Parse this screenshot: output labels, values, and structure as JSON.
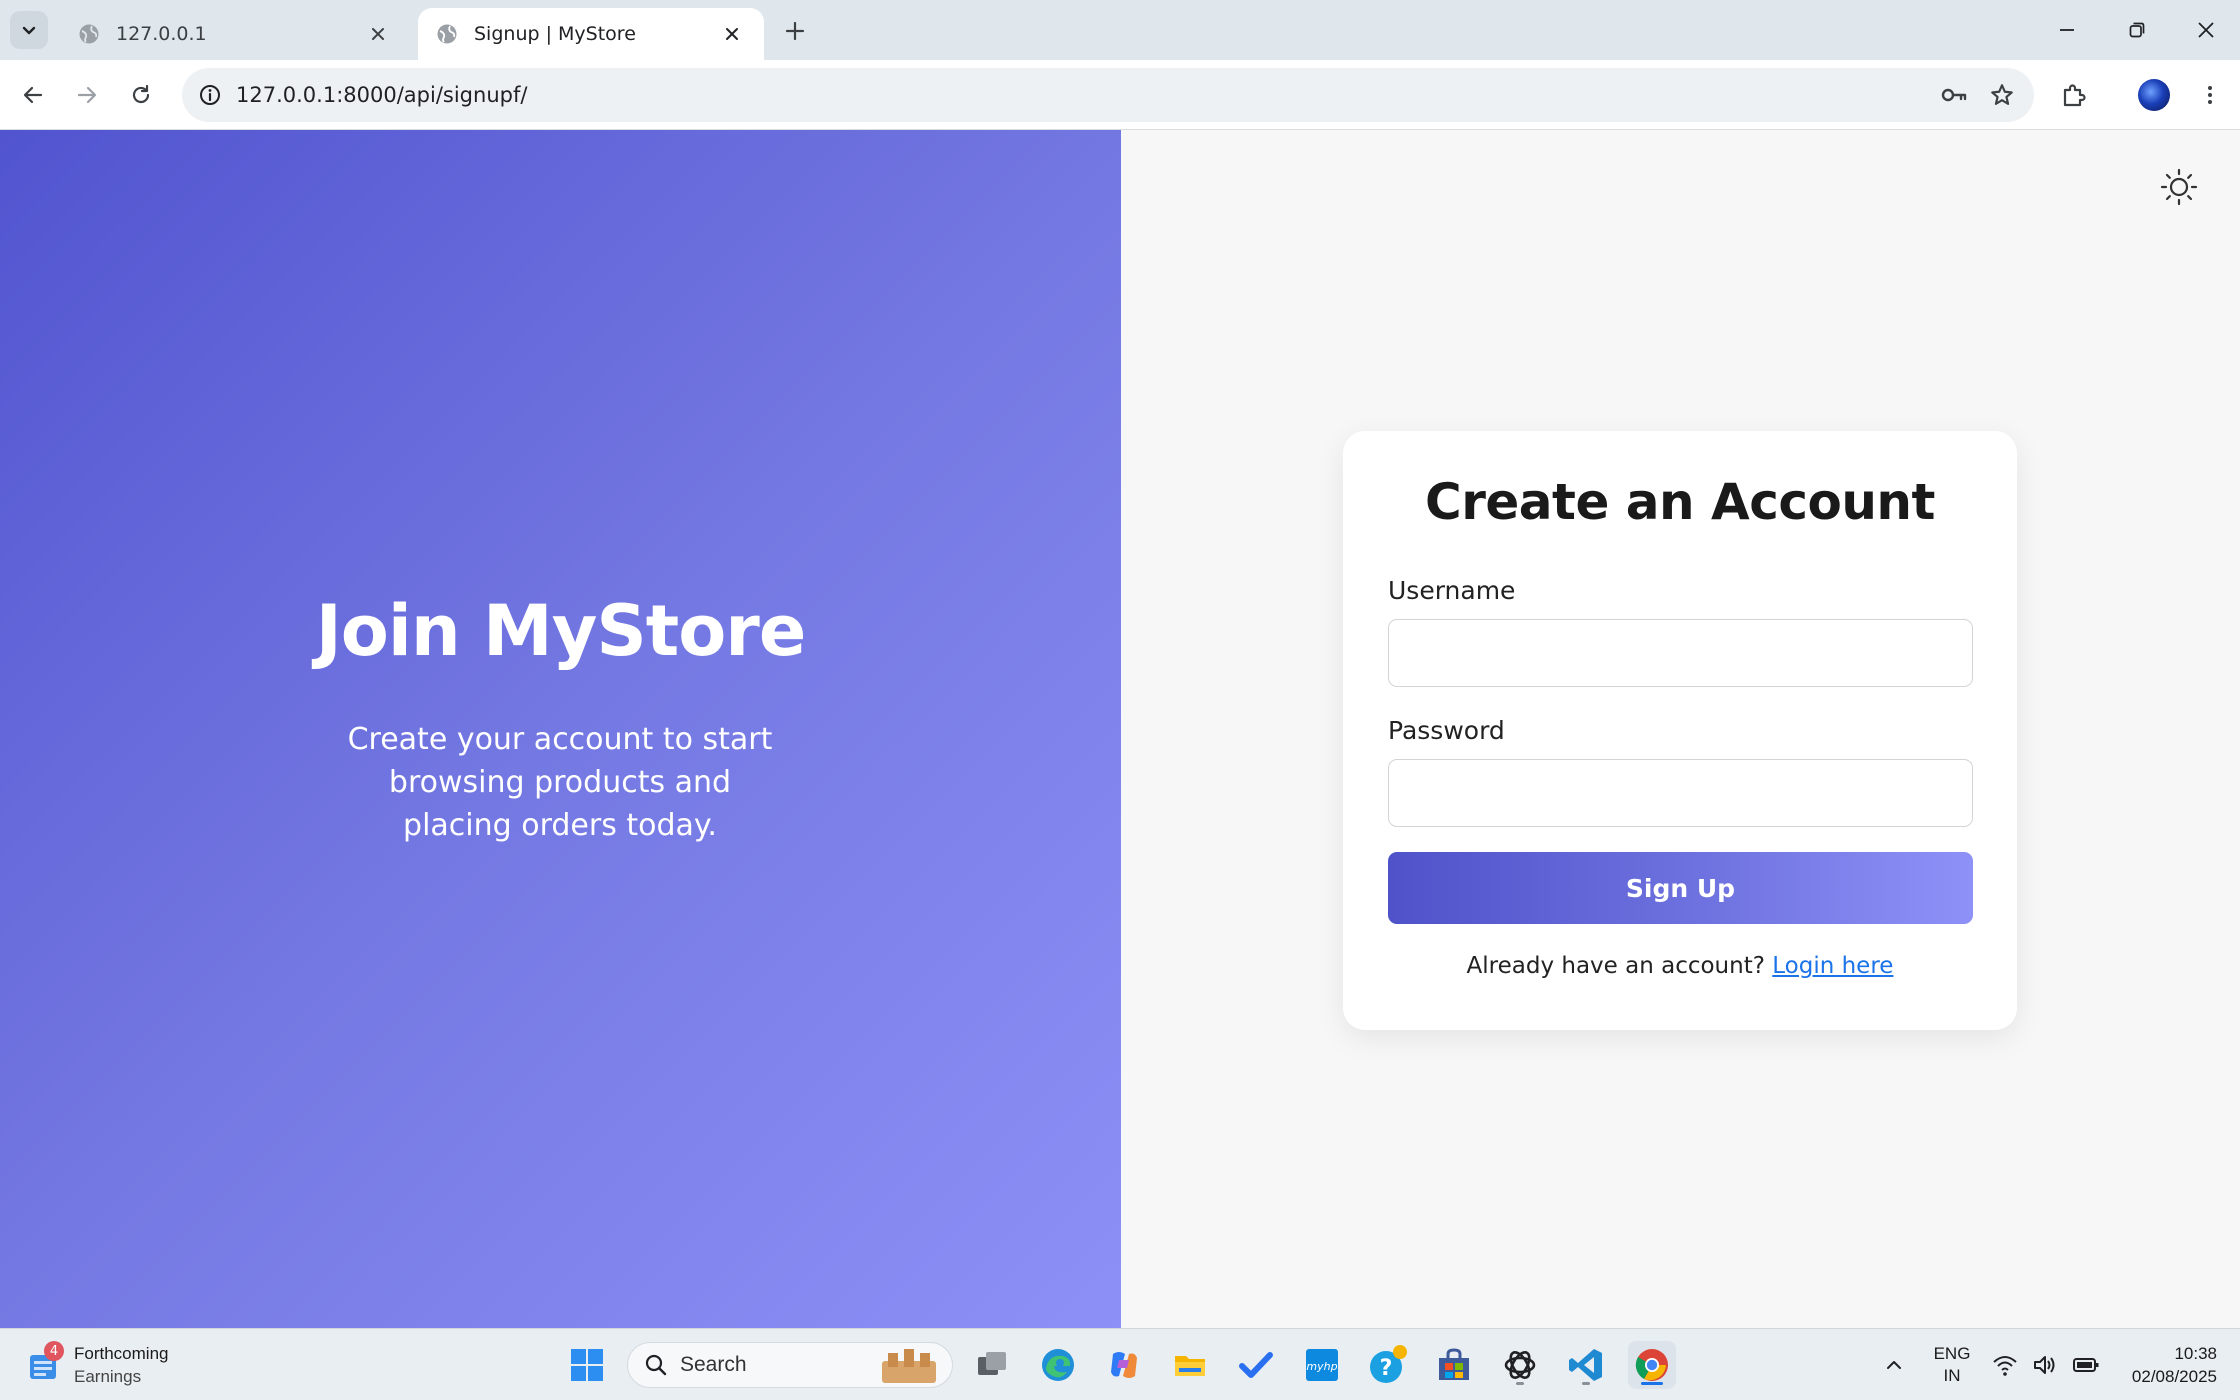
{
  "browser": {
    "tabs": [
      {
        "title": "127.0.0.1",
        "active": false
      },
      {
        "title": "Signup | MyStore",
        "active": true
      }
    ],
    "url": {
      "host": "127.0.0.1",
      "rest": ":8000/api/signupf/"
    }
  },
  "hero": {
    "title": "Join MyStore",
    "subtitle": "Create your account to start browsing products and placing orders today."
  },
  "form": {
    "title": "Create an Account",
    "username_label": "Username",
    "username_value": "",
    "password_label": "Password",
    "password_value": "",
    "submit_label": "Sign Up",
    "login_prompt": "Already have an account? ",
    "login_link": "Login here"
  },
  "taskbar": {
    "widget": {
      "badge": "4",
      "line1": "Forthcoming",
      "line2": "Earnings"
    },
    "search_label": "Search",
    "language": {
      "line1": "ENG",
      "line2": "IN"
    },
    "time": "10:38",
    "date": "02/08/2025"
  },
  "colors": {
    "hero_gradient_start": "#5154cf",
    "hero_gradient_end": "#8d90f6",
    "link": "#1a73e8"
  },
  "icons": [
    "tab-search-icon",
    "globe-icon",
    "close-icon",
    "plus-icon",
    "minimize-icon",
    "restore-icon",
    "back-icon",
    "forward-icon",
    "reload-icon",
    "info-icon",
    "key-icon",
    "star-icon",
    "extensions-icon",
    "menu-icon",
    "sun-icon",
    "windows-icon",
    "search-icon",
    "task-view-icon",
    "edge-icon",
    "copilot-icon",
    "file-explorer-icon",
    "todo-icon",
    "myhp-icon",
    "help-icon",
    "store-icon",
    "chatgpt-icon",
    "vscode-icon",
    "chrome-icon",
    "chevron-up-icon",
    "wifi-icon",
    "volume-icon",
    "battery-icon"
  ]
}
